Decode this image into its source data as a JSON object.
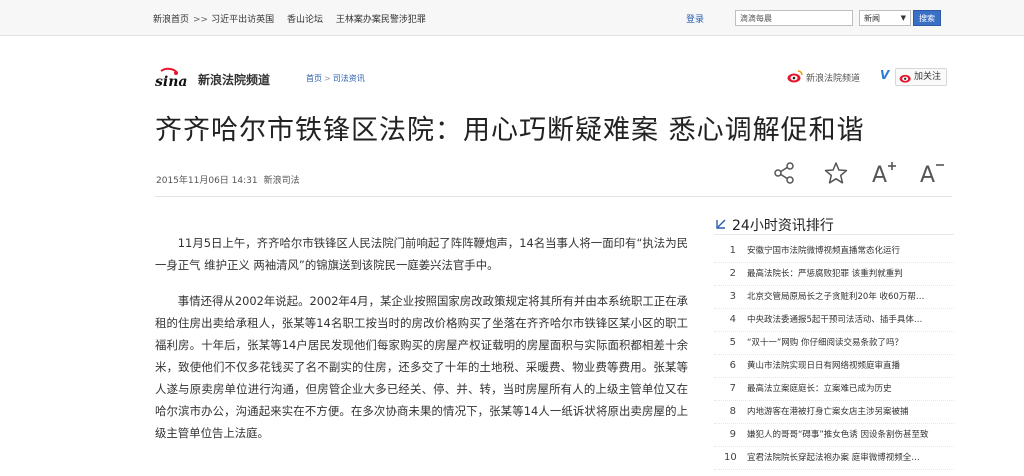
{
  "topbar": {
    "breadcrumb": [
      "新浪首页",
      ">>",
      "习近平出访英国",
      "香山论坛",
      "王林案办案民警涉犯罪"
    ],
    "login_label": "登录",
    "search": {
      "value": "滴滴每晨",
      "select_value": "新闻",
      "button_label": "搜索"
    }
  },
  "channel": {
    "name": "新浪法院频道",
    "crumbs": [
      "首页",
      ">",
      "司法资讯"
    ],
    "weibo_name": "新浪法院频道",
    "verified_mark": "V",
    "follow_label": "加关注"
  },
  "article": {
    "title": "齐齐哈尔市铁锋区法院：用心巧断疑难案 悉心调解促和谐",
    "date": "2015年11月06日 14:31",
    "source": "新浪司法",
    "paragraphs": [
      "11月5日上午，齐齐哈尔市铁锋区人民法院门前响起了阵阵鞭炮声，14名当事人将一面印有“执法为民 一身正气 维护正义 两袖清风”的锦旗送到该院民一庭姜兴法官手中。",
      "事情还得从2002年说起。2002年4月，某企业按照国家房改政策规定将其所有并由本系统职工正在承租的住房出卖给承租人，张某等14名职工按当时的房改价格购买了坐落在齐齐哈尔市铁锋区某小区的职工福利房。十年后，张某等14户居民发现他们每家购买的房屋产权证载明的房屋面积与实际面积都相差十余米，致使他们不仅多花钱买了名不副实的住房，还多交了十年的土地税、采暖费、物业费等费用。张某等人遂与原卖房单位进行沟通，但房管企业大多已经关、停、并、转，当时房屋所有人的上级主管单位又在哈尔滨市办公，沟通起来实在不方便。在多次协商未果的情况下，张某等14人一纸诉状将原出卖房屋的上级主管单位告上法庭。"
    ]
  },
  "tools": [
    "share-icon",
    "star-icon",
    "font-increase-icon",
    "font-decrease-icon"
  ],
  "ranking": {
    "title": "24小时资讯排行",
    "items": [
      {
        "num": "1",
        "text": "安徽宁国市法院微博视频直播常态化运行"
      },
      {
        "num": "2",
        "text": "最高法院长：严惩腐败犯罪 该重判就重判"
      },
      {
        "num": "3",
        "text": "北京交管局原局长之子贪赃利20年 收60万帮…"
      },
      {
        "num": "4",
        "text": "中央政法委通报5起干预司法活动、插手具体…"
      },
      {
        "num": "5",
        "text": "“双十一”网购 你仔细阅读交易条款了吗？"
      },
      {
        "num": "6",
        "text": "黄山市法院实现日日有网络视频庭审直播"
      },
      {
        "num": "7",
        "text": "最高法立案庭庭长：立案难已成为历史"
      },
      {
        "num": "8",
        "text": "内地游客在港被打身亡案女店主涉另案被捕"
      },
      {
        "num": "9",
        "text": "嫌犯人的哥哥“碍事”推女色诱 因设条割伤甚至致"
      },
      {
        "num": "10",
        "text": "宜君法院院长穿起法袍办案 庭审微博视频全…"
      }
    ]
  },
  "colors": {
    "link": "#2a5db0",
    "search_button": "#3a6fc6",
    "weibo_red": "#e6162d"
  }
}
